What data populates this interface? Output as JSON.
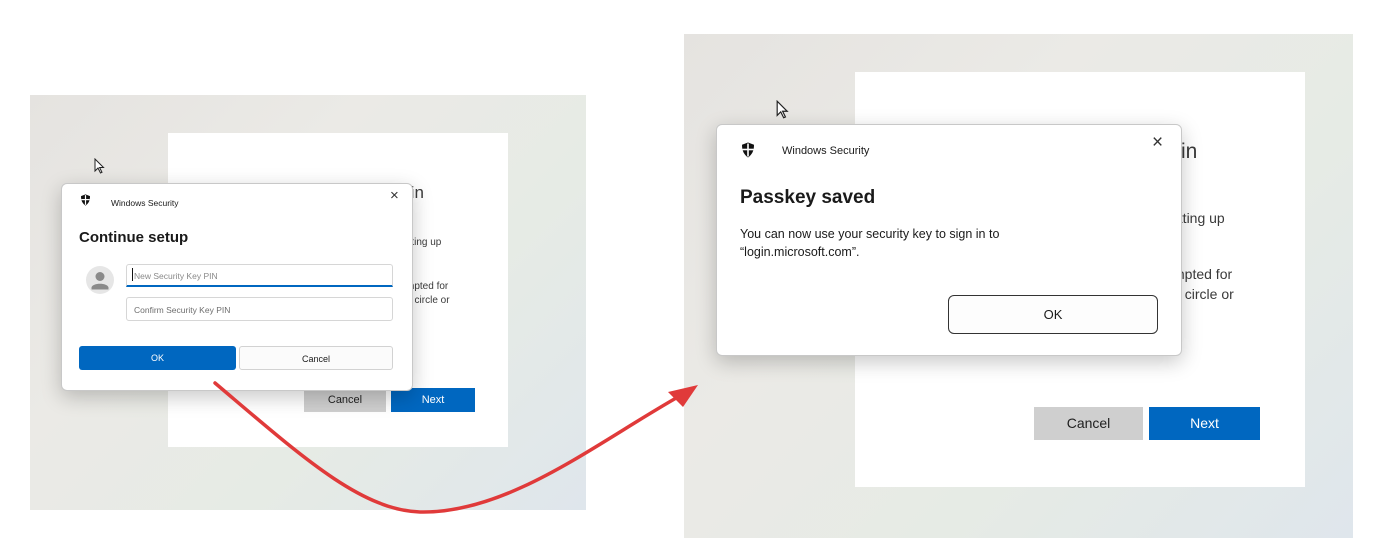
{
  "left_screen": {
    "background": {
      "title_fragment": "-in",
      "line1_fragment": "etting up",
      "line2_fragment": "mpted for",
      "line3_fragment": "ld circle or",
      "cancel_label": "Cancel",
      "next_label": "Next"
    },
    "dialog": {
      "app_title": "Windows Security",
      "heading": "Continue setup",
      "pin_placeholder": "New Security Key PIN",
      "confirm_placeholder": "Confirm Security Key PIN",
      "ok_label": "OK",
      "cancel_label": "Cancel",
      "close_symbol": "×"
    }
  },
  "right_screen": {
    "background": {
      "title_fragment": "-in",
      "line1_fragment": "etting up",
      "line2_fragment": "mpted for",
      "line3_fragment": "ld circle or",
      "cancel_label": "Cancel",
      "next_label": "Next"
    },
    "dialog": {
      "app_title": "Windows Security",
      "heading": "Passkey saved",
      "message_line1": "You can now use your security key to sign in to",
      "message_line2": "“login.microsoft.com”.",
      "ok_label": "OK",
      "close_symbol": "×"
    }
  },
  "colors": {
    "accent_blue": "#0067c0",
    "arrow_red": "#e03a3a",
    "button_gray": "#cfcfcf"
  },
  "icons": [
    "shield-icon",
    "avatar-icon",
    "close-icon",
    "mouse-cursor-icon",
    "arrow-annotation"
  ]
}
